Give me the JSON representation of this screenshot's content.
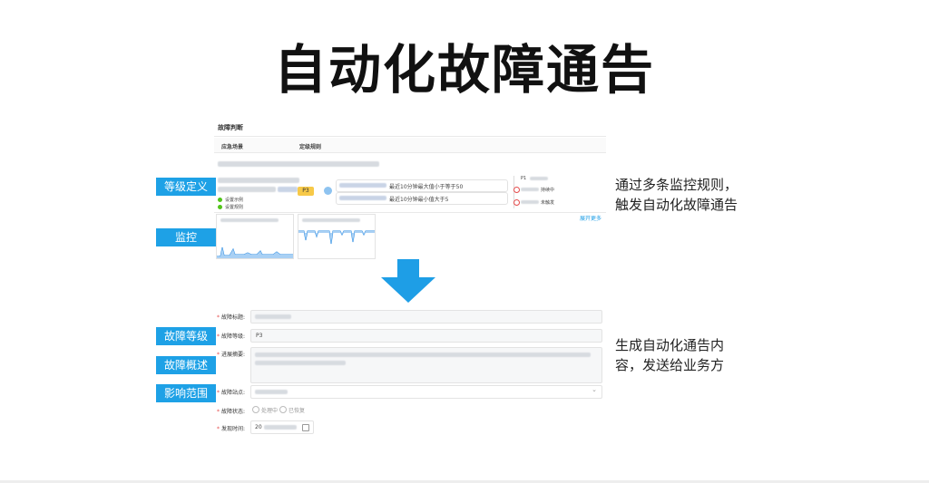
{
  "slide": {
    "title": "自动化故障通告"
  },
  "tags": {
    "level_def": "等级定义",
    "monitor": "监控",
    "fault_level": "故障等级",
    "fault_summary": "故障概述",
    "impact_scope": "影响范围"
  },
  "descriptions": {
    "top_line1": "通过多条监控规则，",
    "top_line2": "触发自动化故障通告",
    "bottom_line1": "生成自动化通告内",
    "bottom_line2": "容，发送给业务方"
  },
  "judge_panel": {
    "header": "故障判断",
    "col_scenario": "应急场景",
    "col_rule": "定级规则",
    "level_badge": "P3",
    "status_1": "设置示例",
    "status_2": "设置规则",
    "rule_1": "最近10分钟最大值小于等于50",
    "rule_2": "最近10分钟最小值大于5",
    "legend_p": "P1",
    "legend_1": "持续中",
    "legend_2": "未触发",
    "expand": "展开更多"
  },
  "form": {
    "title_label": "故障标题:",
    "level_label": "故障等级:",
    "level_value": "P3",
    "progress_label": "进展摘要:",
    "site_label": "故障站点:",
    "status_label": "故障状态:",
    "status_opt_1": "处理中",
    "status_opt_2": "已恢复",
    "time_label": "发现时间:",
    "time_prefix": "20"
  },
  "colors": {
    "tag_bg": "#1ea1e6",
    "arrow": "#1e9ee6",
    "badge": "#f7c948",
    "ok_green": "#52c41a",
    "danger": "#e54c4c"
  },
  "icons": {
    "arrow": "arrow-down-icon",
    "calendar": "calendar-icon",
    "dropdown": "chevron-down-icon"
  }
}
